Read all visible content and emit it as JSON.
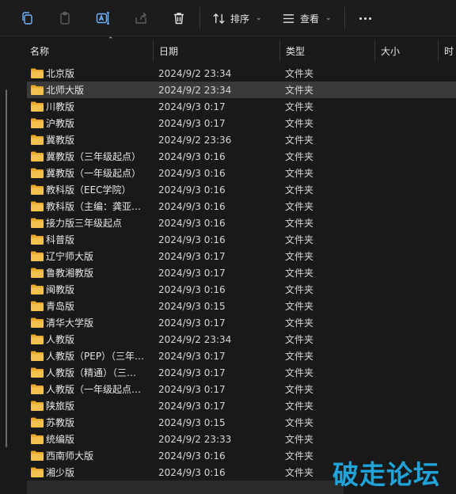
{
  "toolbar": {
    "sort_label": "排序",
    "view_label": "查看"
  },
  "columns": {
    "name": "名称",
    "date": "日期",
    "type": "类型",
    "size": "大小",
    "time": "时"
  },
  "rows": [
    {
      "name": "北京版",
      "date": "2024/9/2 23:34",
      "type": "文件夹"
    },
    {
      "name": "北师大版",
      "date": "2024/9/2 23:34",
      "type": "文件夹",
      "selected": true
    },
    {
      "name": "川教版",
      "date": "2024/9/3 0:17",
      "type": "文件夹"
    },
    {
      "name": "沪教版",
      "date": "2024/9/3 0:17",
      "type": "文件夹"
    },
    {
      "name": "冀教版",
      "date": "2024/9/2 23:36",
      "type": "文件夹"
    },
    {
      "name": "冀教版（三年级起点）",
      "date": "2024/9/3 0:16",
      "type": "文件夹"
    },
    {
      "name": "冀教版（一年级起点）",
      "date": "2024/9/3 0:16",
      "type": "文件夹"
    },
    {
      "name": "教科版（EEC学院）",
      "date": "2024/9/3 0:16",
      "type": "文件夹"
    },
    {
      "name": "教科版（主编：龚亚…",
      "date": "2024/9/3 0:16",
      "type": "文件夹"
    },
    {
      "name": "接力版三年级起点",
      "date": "2024/9/3 0:16",
      "type": "文件夹"
    },
    {
      "name": "科普版",
      "date": "2024/9/3 0:16",
      "type": "文件夹"
    },
    {
      "name": "辽宁师大版",
      "date": "2024/9/3 0:17",
      "type": "文件夹"
    },
    {
      "name": "鲁教湘教版",
      "date": "2024/9/3 0:17",
      "type": "文件夹"
    },
    {
      "name": "闽教版",
      "date": "2024/9/3 0:16",
      "type": "文件夹"
    },
    {
      "name": "青岛版",
      "date": "2024/9/3 0:15",
      "type": "文件夹"
    },
    {
      "name": "清华大学版",
      "date": "2024/9/3 0:17",
      "type": "文件夹"
    },
    {
      "name": "人教版",
      "date": "2024/9/2 23:34",
      "type": "文件夹"
    },
    {
      "name": "人教版（PEP）（三年…",
      "date": "2024/9/3 0:17",
      "type": "文件夹"
    },
    {
      "name": "人教版（精通）（三…",
      "date": "2024/9/3 0:17",
      "type": "文件夹"
    },
    {
      "name": "人教版（一年级起点…",
      "date": "2024/9/3 0:17",
      "type": "文件夹"
    },
    {
      "name": "陕旅版",
      "date": "2024/9/3 0:17",
      "type": "文件夹"
    },
    {
      "name": "苏教版",
      "date": "2024/9/3 0:15",
      "type": "文件夹"
    },
    {
      "name": "统编版",
      "date": "2024/9/2 23:33",
      "type": "文件夹"
    },
    {
      "name": "西南师大版",
      "date": "2024/9/3 0:16",
      "type": "文件夹"
    },
    {
      "name": "湘少版",
      "date": "2024/9/3 0:16",
      "type": "文件夹"
    }
  ],
  "watermark": "破走论坛",
  "colors": {
    "background": "#191919",
    "selected_row": "#3a3a3a",
    "folder": "#f2c14e",
    "watermark": "#1fa3d8"
  },
  "icons": [
    "copy-icon",
    "paste-icon",
    "rename-icon",
    "share-icon",
    "delete-icon",
    "sort-icon",
    "view-icon",
    "more-icon",
    "folder-icon"
  ]
}
